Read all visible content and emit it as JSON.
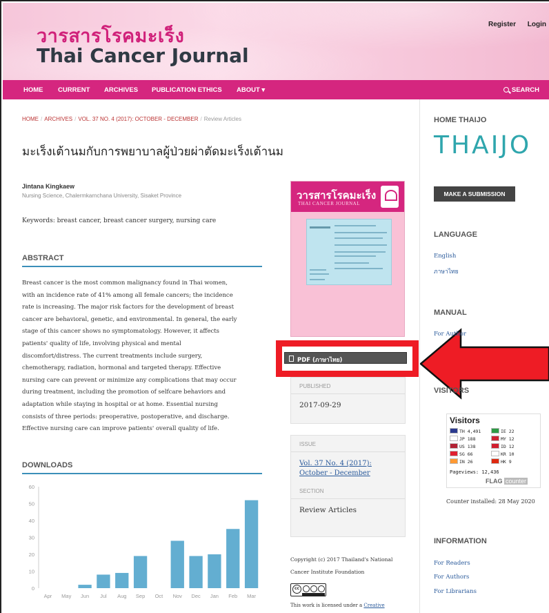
{
  "header": {
    "logo_thai": "วารสารโรคมะเร็ง",
    "logo_en": "Thai Cancer Journal",
    "register": "Register",
    "login": "Login"
  },
  "nav": {
    "items": [
      "HOME",
      "CURRENT",
      "ARCHIVES",
      "PUBLICATION ETHICS",
      "ABOUT ▾"
    ],
    "search": "SEARCH"
  },
  "breadcrumb": {
    "home": "HOME",
    "archives": "ARCHIVES",
    "issue": "VOL. 37 NO. 4 (2017): OCTOBER - DECEMBER",
    "current": "Review Articles"
  },
  "article": {
    "title": "มะเร็งเต้านมกับการพยาบาลผู้ป่วยผ่าตัดมะเร็งเต้านม",
    "author": "Jintana Kingkaew",
    "affiliation": "Nursing Science, Chalermkarnchana University, Sisaket Province",
    "keywords": "Keywords: breast cancer, breast cancer surgery, nursing care",
    "abstract_heading": "ABSTRACT",
    "abstract_lines": [
      "Breast cancer is the most common malignancy found in Thai women,",
      "with an incidence rate of 41% among all female cancers; the incidence",
      "rate is increasing. The major risk factors for the development of breast",
      "cancer are behavioral, genetic, and environmental. In general, the early",
      "stage of this cancer shows no symptomatology. However, it affects",
      "patients' quality of life, involving physical and mental",
      "discomfort/distress. The current treatments include surgery,",
      "chemotherapy, radiation, hormonal and targeted therapy. Effective",
      "nursing care can prevent or minimize any complications that may occur",
      "during treatment, including the promotion of selfcare behaviors and",
      "adaptation while staying in hospital or at home. Essential nursing",
      "consists of three periods: preoperative, postoperative, and discharge.",
      "Effective nursing care can improve patients' overall quality of life."
    ],
    "downloads_heading": "DOWNLOADS"
  },
  "chart_data": {
    "type": "bar",
    "categories": [
      "Apr",
      "May",
      "Jun",
      "Jul",
      "Aug",
      "Sep",
      "Oct",
      "Nov",
      "Dec",
      "Jan",
      "Feb",
      "Mar"
    ],
    "values": [
      0,
      0,
      2,
      8,
      9,
      19,
      0,
      28,
      19,
      20,
      35,
      52
    ],
    "yticks": [
      0,
      10,
      20,
      30,
      40,
      50,
      60
    ],
    "ylim": [
      0,
      60
    ],
    "bar_color": "#63aed1",
    "grid": false
  },
  "cover": {
    "title": "วารสารโรคมะเร็ง",
    "subtitle": "THAI CANCER JOURNAL"
  },
  "pdf": {
    "label": "PDF (ภาษาไทย)"
  },
  "published": {
    "label": "PUBLISHED",
    "value": "2017-09-29"
  },
  "issue": {
    "label": "ISSUE",
    "link": "Vol. 37 No. 4 (2017): October - December"
  },
  "section": {
    "label": "SECTION",
    "value": "Review Articles"
  },
  "copyright": {
    "text": "Copyright (c) 2017 Thailand's National Cancer Institute Foundation",
    "license_prefix": "This work is licensed under a ",
    "license_link": "Creative"
  },
  "sidebar": {
    "home_thaijo_heading": "HOME THAIJO",
    "thaijo_logo": "THAIJO",
    "submit_button": "MAKE A SUBMISSION",
    "language_heading": "LANGUAGE",
    "languages": [
      "English",
      "ภาษาไทย"
    ],
    "manual_heading": "MANUAL",
    "manual_link": "For Author",
    "visitors_heading": "VISITORS",
    "visitors_title": "Visitors",
    "visitor_counts": [
      {
        "code": "TH",
        "count": "4,491",
        "flag_color": "#2b3a8f"
      },
      {
        "code": "IE",
        "count": "22",
        "flag_color": "#2e9a45"
      },
      {
        "code": "JP",
        "count": "188",
        "flag_color": "#ffffff"
      },
      {
        "code": "MY",
        "count": "12",
        "flag_color": "#cc2233"
      },
      {
        "code": "US",
        "count": "138",
        "flag_color": "#b22234"
      },
      {
        "code": "ID",
        "count": "12",
        "flag_color": "#d11f2f"
      },
      {
        "code": "SG",
        "count": "66",
        "flag_color": "#e02030"
      },
      {
        "code": "KR",
        "count": "10",
        "flag_color": "#ffffff"
      },
      {
        "code": "IN",
        "count": "26",
        "flag_color": "#ff9933"
      },
      {
        "code": "HK",
        "count": "9",
        "flag_color": "#de2910"
      }
    ],
    "pageviews": "Pageviews: 12,436",
    "flag_counter_main": "FLAG",
    "flag_counter_sub": "counter",
    "counter_note": "Counter installed: 28 May 2020",
    "information_heading": "INFORMATION",
    "information_links": [
      "For Readers",
      "For Authors",
      "For Librarians"
    ]
  }
}
